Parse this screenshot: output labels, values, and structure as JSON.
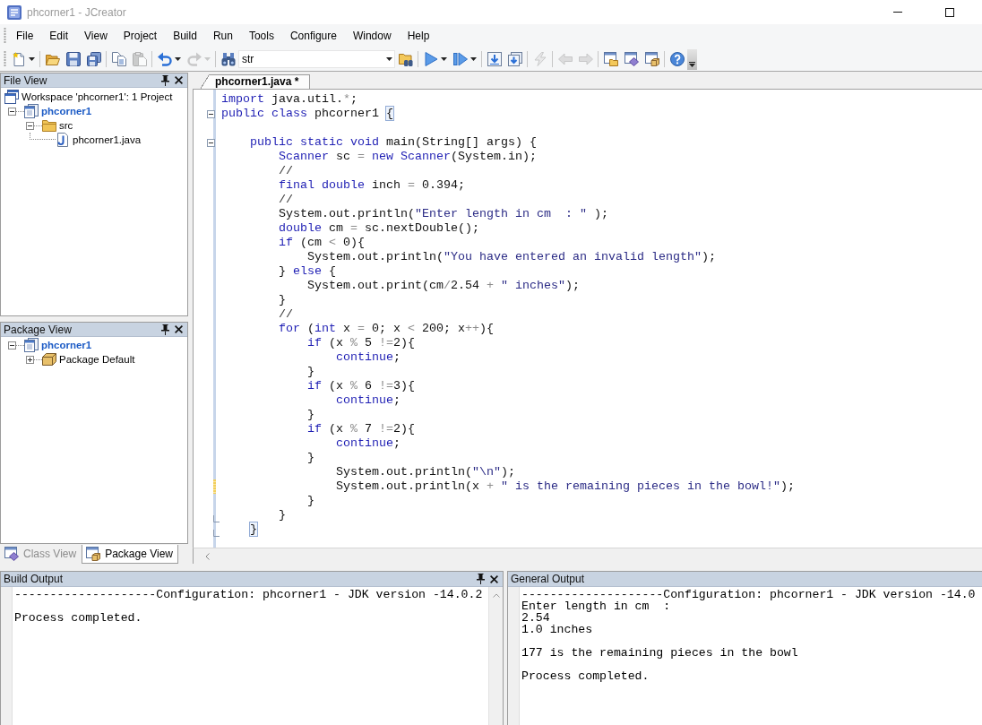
{
  "window": {
    "title": "phcorner1 - JCreator"
  },
  "menu": [
    "File",
    "Edit",
    "View",
    "Project",
    "Build",
    "Run",
    "Tools",
    "Configure",
    "Window",
    "Help"
  ],
  "toolbar": {
    "groups": [
      [
        {
          "kind": "new",
          "has_menu": true,
          "disabled": false
        }
      ],
      [
        {
          "kind": "open",
          "has_menu": false,
          "disabled": false
        },
        {
          "kind": "save",
          "has_menu": false,
          "disabled": false
        },
        {
          "kind": "save_all",
          "has_menu": false,
          "disabled": false
        }
      ],
      [
        {
          "kind": "copy",
          "has_menu": false,
          "disabled": false
        },
        {
          "kind": "paste",
          "has_menu": false,
          "disabled": true
        }
      ],
      [
        {
          "kind": "undo",
          "has_menu": true,
          "disabled": false
        },
        {
          "kind": "redo",
          "has_menu": true,
          "disabled": true
        }
      ],
      [
        {
          "kind": "find",
          "has_menu": false,
          "disabled": false
        },
        {
          "kind": "search_combo",
          "value": "str"
        },
        {
          "kind": "find_in_files",
          "has_menu": false,
          "disabled": false
        }
      ],
      [
        {
          "kind": "run",
          "has_menu": true,
          "disabled": false
        },
        {
          "kind": "debug",
          "has_menu": true,
          "disabled": false
        }
      ],
      [
        {
          "kind": "page_arrow",
          "has_menu": false,
          "disabled": false
        },
        {
          "kind": "pages_arrow",
          "has_menu": false,
          "disabled": false
        }
      ],
      [
        {
          "kind": "lightning",
          "has_menu": false,
          "disabled": true
        }
      ],
      [
        {
          "kind": "back",
          "has_menu": false,
          "disabled": true
        },
        {
          "kind": "forward",
          "has_menu": false,
          "disabled": true
        }
      ],
      [
        {
          "kind": "window_folder",
          "has_menu": false,
          "disabled": false
        },
        {
          "kind": "window_tool",
          "has_menu": false,
          "disabled": false
        },
        {
          "kind": "window_box",
          "has_menu": false,
          "disabled": false
        }
      ],
      [
        {
          "kind": "help",
          "has_menu": false,
          "disabled": false
        }
      ]
    ]
  },
  "file_view": {
    "title": "File View",
    "tree": [
      {
        "kind": "workspace",
        "label": "Workspace 'phcorner1': 1 Project",
        "children": [
          {
            "kind": "project",
            "label": "phcorner1",
            "expanded": true,
            "children": [
              {
                "kind": "folder",
                "label": "src",
                "expanded": true,
                "children": [
                  {
                    "kind": "java_file",
                    "label": "phcorner1.java"
                  }
                ]
              }
            ]
          }
        ]
      }
    ]
  },
  "package_view": {
    "title": "Package View",
    "tree": [
      {
        "kind": "project",
        "label": "phcorner1",
        "expanded": true,
        "children": [
          {
            "kind": "package",
            "label": "Package Default",
            "expanded": false
          }
        ]
      }
    ]
  },
  "side_tabs": [
    {
      "kind": "class",
      "label": "Class View",
      "selected": false
    },
    {
      "kind": "package",
      "label": "Package View",
      "selected": true
    }
  ],
  "editor": {
    "tabs": [
      {
        "label": "phcorner1.java *",
        "selected": true
      }
    ],
    "lines": [
      {
        "kind": "code",
        "modified": false,
        "tokens": [
          {
            "kind": "keyword",
            "text": "import"
          },
          {
            "kind": "plain",
            "text": " java.util."
          },
          {
            "kind": "operator",
            "text": "*"
          },
          {
            "kind": "plain",
            "text": ";"
          }
        ]
      },
      {
        "kind": "fold_start",
        "modified": false,
        "tokens": [
          {
            "kind": "keyword",
            "text": "public class"
          },
          {
            "kind": "plain",
            "text": " phcorner1 "
          },
          {
            "kind": "matched_brace",
            "text": "{"
          }
        ],
        "children": [
          {
            "kind": "blank"
          },
          {
            "kind": "fold_start",
            "modified": false,
            "tokens": [
              {
                "kind": "keyword",
                "text": "public static void"
              },
              {
                "kind": "plain",
                "text": " main(String[] args) {"
              }
            ],
            "children": [
              {
                "kind": "code",
                "modified": false,
                "tokens": [
                  {
                    "kind": "keyword",
                    "text": "Scanner"
                  },
                  {
                    "kind": "plain",
                    "text": " sc "
                  },
                  {
                    "kind": "operator",
                    "text": "= "
                  },
                  {
                    "kind": "keyword",
                    "text": "new Scanner"
                  },
                  {
                    "kind": "plain",
                    "text": "(System.in);"
                  }
                ]
              },
              {
                "kind": "code",
                "modified": false,
                "tokens": [
                  {
                    "kind": "comment",
                    "text": "//"
                  }
                ]
              },
              {
                "kind": "code",
                "modified": false,
                "tokens": [
                  {
                    "kind": "keyword",
                    "text": "final double"
                  },
                  {
                    "kind": "plain",
                    "text": " inch "
                  },
                  {
                    "kind": "operator",
                    "text": "="
                  },
                  {
                    "kind": "plain",
                    "text": " 0.394;"
                  }
                ]
              },
              {
                "kind": "code",
                "modified": false,
                "tokens": [
                  {
                    "kind": "comment",
                    "text": "//"
                  }
                ]
              },
              {
                "kind": "code",
                "modified": false,
                "tokens": [
                  {
                    "kind": "plain",
                    "text": "System.out.println("
                  },
                  {
                    "kind": "string",
                    "text": "\"Enter length in cm  : \""
                  },
                  {
                    "kind": "plain",
                    "text": " );"
                  }
                ]
              },
              {
                "kind": "code",
                "modified": false,
                "tokens": [
                  {
                    "kind": "keyword",
                    "text": "double"
                  },
                  {
                    "kind": "plain",
                    "text": " cm "
                  },
                  {
                    "kind": "operator",
                    "text": "="
                  },
                  {
                    "kind": "plain",
                    "text": " sc.nextDouble();"
                  }
                ]
              },
              {
                "kind": "code",
                "modified": false,
                "tokens": [
                  {
                    "kind": "keyword",
                    "text": "if"
                  },
                  {
                    "kind": "plain",
                    "text": " (cm "
                  },
                  {
                    "kind": "operator",
                    "text": "<"
                  },
                  {
                    "kind": "plain",
                    "text": " 0){"
                  }
                ],
                "children": [
                  {
                    "kind": "code",
                    "modified": false,
                    "tokens": [
                      {
                        "kind": "plain",
                        "text": "System.out.println("
                      },
                      {
                        "kind": "string",
                        "text": "\"You have entered an invalid length\""
                      },
                      {
                        "kind": "plain",
                        "text": ");"
                      }
                    ]
                  }
                ]
              },
              {
                "kind": "code",
                "modified": false,
                "tokens": [
                  {
                    "kind": "plain",
                    "text": "} "
                  },
                  {
                    "kind": "keyword",
                    "text": "else"
                  },
                  {
                    "kind": "plain",
                    "text": " {"
                  }
                ],
                "children": [
                  {
                    "kind": "code",
                    "modified": false,
                    "tokens": [
                      {
                        "kind": "plain",
                        "text": "System.out.print(cm"
                      },
                      {
                        "kind": "operator",
                        "text": "/"
                      },
                      {
                        "kind": "plain",
                        "text": "2.54 "
                      },
                      {
                        "kind": "operator",
                        "text": "+ "
                      },
                      {
                        "kind": "string",
                        "text": "\" inches\""
                      },
                      {
                        "kind": "plain",
                        "text": ");"
                      }
                    ]
                  }
                ]
              },
              {
                "kind": "code",
                "modified": false,
                "tokens": [
                  {
                    "kind": "plain",
                    "text": "}"
                  }
                ]
              },
              {
                "kind": "code",
                "modified": false,
                "tokens": [
                  {
                    "kind": "comment",
                    "text": "//"
                  }
                ]
              },
              {
                "kind": "code",
                "modified": false,
                "tokens": [
                  {
                    "kind": "keyword",
                    "text": "for"
                  },
                  {
                    "kind": "plain",
                    "text": " ("
                  },
                  {
                    "kind": "keyword",
                    "text": "int"
                  },
                  {
                    "kind": "plain",
                    "text": " x "
                  },
                  {
                    "kind": "operator",
                    "text": "="
                  },
                  {
                    "kind": "plain",
                    "text": " 0; x "
                  },
                  {
                    "kind": "operator",
                    "text": "<"
                  },
                  {
                    "kind": "plain",
                    "text": " 200; x"
                  },
                  {
                    "kind": "operator",
                    "text": "++"
                  },
                  {
                    "kind": "plain",
                    "text": "){"
                  }
                ],
                "children": [
                  {
                    "kind": "code",
                    "modified": false,
                    "tokens": [
                      {
                        "kind": "keyword",
                        "text": "if"
                      },
                      {
                        "kind": "plain",
                        "text": " (x "
                      },
                      {
                        "kind": "operator",
                        "text": "%"
                      },
                      {
                        "kind": "plain",
                        "text": " 5 "
                      },
                      {
                        "kind": "operator",
                        "text": "!="
                      },
                      {
                        "kind": "plain",
                        "text": "2){"
                      }
                    ],
                    "children": [
                      {
                        "kind": "code",
                        "modified": false,
                        "tokens": [
                          {
                            "kind": "keyword",
                            "text": "continue"
                          },
                          {
                            "kind": "plain",
                            "text": ";"
                          }
                        ]
                      }
                    ]
                  },
                  {
                    "kind": "code",
                    "modified": false,
                    "tokens": [
                      {
                        "kind": "plain",
                        "text": "}"
                      }
                    ]
                  },
                  {
                    "kind": "code",
                    "modified": false,
                    "tokens": [
                      {
                        "kind": "keyword",
                        "text": "if"
                      },
                      {
                        "kind": "plain",
                        "text": " (x "
                      },
                      {
                        "kind": "operator",
                        "text": "%"
                      },
                      {
                        "kind": "plain",
                        "text": " 6 "
                      },
                      {
                        "kind": "operator",
                        "text": "!="
                      },
                      {
                        "kind": "plain",
                        "text": "3){"
                      }
                    ],
                    "children": [
                      {
                        "kind": "code",
                        "modified": false,
                        "tokens": [
                          {
                            "kind": "keyword",
                            "text": "continue"
                          },
                          {
                            "kind": "plain",
                            "text": ";"
                          }
                        ]
                      }
                    ]
                  },
                  {
                    "kind": "code",
                    "modified": false,
                    "tokens": [
                      {
                        "kind": "plain",
                        "text": "}"
                      }
                    ]
                  },
                  {
                    "kind": "code",
                    "modified": false,
                    "tokens": [
                      {
                        "kind": "keyword",
                        "text": "if"
                      },
                      {
                        "kind": "plain",
                        "text": " (x "
                      },
                      {
                        "kind": "operator",
                        "text": "%"
                      },
                      {
                        "kind": "plain",
                        "text": " 7 "
                      },
                      {
                        "kind": "operator",
                        "text": "!="
                      },
                      {
                        "kind": "plain",
                        "text": "2){"
                      }
                    ],
                    "children": [
                      {
                        "kind": "code",
                        "modified": false,
                        "tokens": [
                          {
                            "kind": "keyword",
                            "text": "continue"
                          },
                          {
                            "kind": "plain",
                            "text": ";"
                          }
                        ]
                      }
                    ]
                  },
                  {
                    "kind": "code",
                    "modified": false,
                    "tokens": [
                      {
                        "kind": "plain",
                        "text": "}"
                      }
                    ],
                    "children": [
                      {
                        "kind": "code",
                        "modified": false,
                        "tokens": [
                          {
                            "kind": "plain",
                            "text": "System.out.println("
                          },
                          {
                            "kind": "string",
                            "text": "\"\\n\""
                          },
                          {
                            "kind": "plain",
                            "text": ");"
                          }
                        ]
                      },
                      {
                        "kind": "code",
                        "modified": true,
                        "tokens": [
                          {
                            "kind": "plain",
                            "text": "System.out.println(x "
                          },
                          {
                            "kind": "operator",
                            "text": "+ "
                          },
                          {
                            "kind": "string",
                            "text": "\" is the remaining pieces in the bowl!\""
                          },
                          {
                            "kind": "plain",
                            "text": ");"
                          }
                        ]
                      }
                    ]
                  },
                  {
                    "kind": "code",
                    "modified": false,
                    "tokens": [
                      {
                        "kind": "plain",
                        "text": "}"
                      }
                    ]
                  }
                ]
              },
              {
                "kind": "fold_end",
                "modified": false,
                "tokens": [
                  {
                    "kind": "plain",
                    "text": "}"
                  }
                ]
              }
            ]
          },
          {
            "kind": "fold_end",
            "modified": false,
            "tokens": [
              {
                "kind": "matched_brace",
                "text": "}"
              }
            ]
          }
        ]
      }
    ]
  },
  "build_output": {
    "title": "Build Output",
    "blocks": [
      [
        "--------------------Configuration: phcorner1 - JDK version -14.0.2"
      ],
      [
        "Process completed."
      ]
    ]
  },
  "general_output": {
    "title": "General Output",
    "blocks": [
      [
        "--------------------Configuration: phcorner1 - JDK version -14.0",
        "Enter length in cm  :",
        "2.54",
        "1.0 inches"
      ],
      [
        "177 is the remaining pieces in the bowl"
      ],
      [
        "Process completed."
      ]
    ]
  }
}
